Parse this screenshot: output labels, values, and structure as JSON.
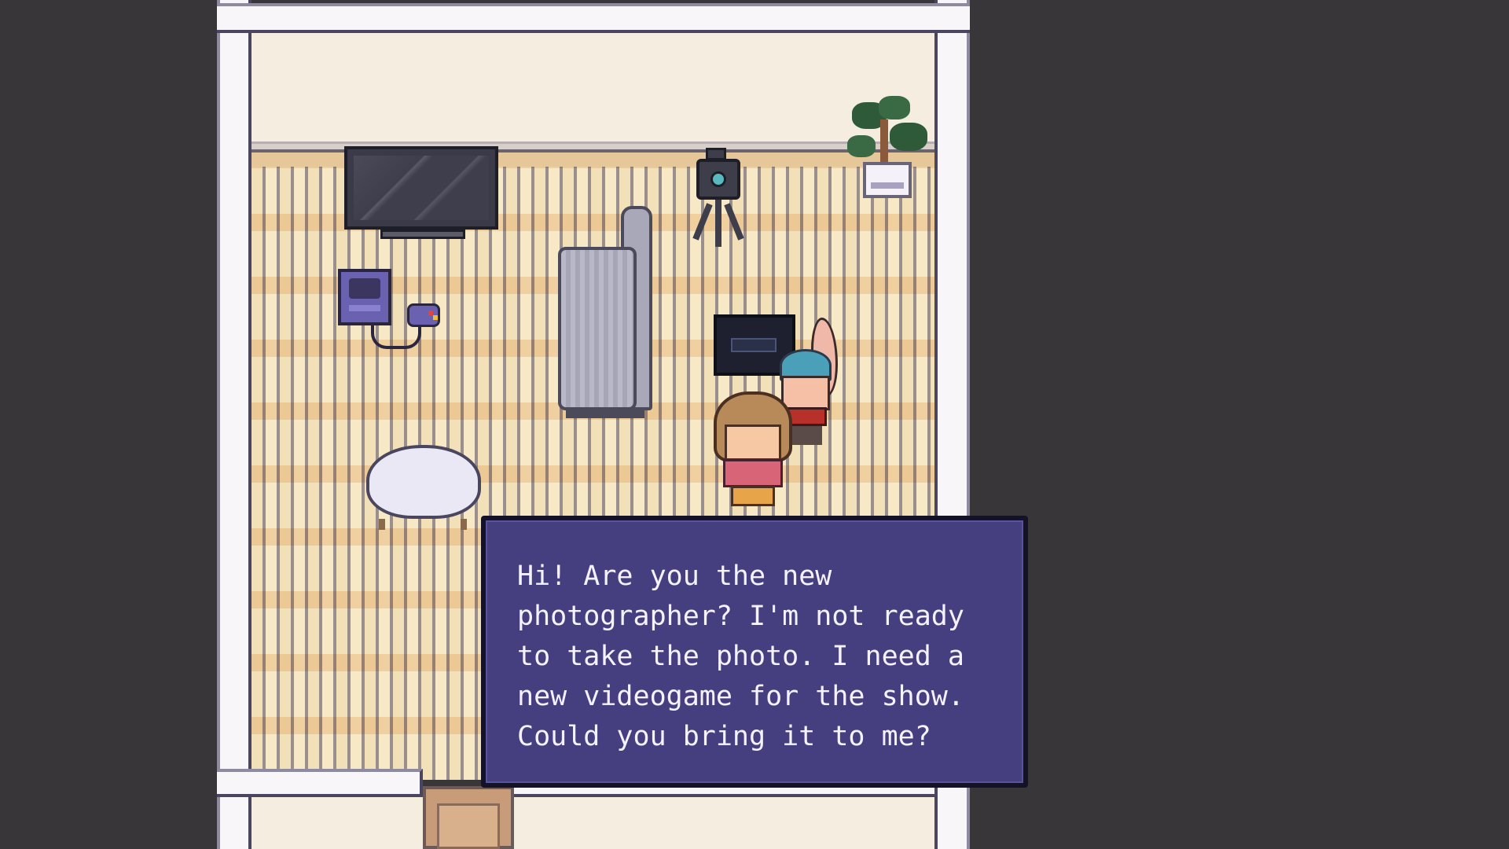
{
  "dialog": {
    "text": "Hi! Are you the new photographer? I'm not ready to take the photo. I need a new videogame for the show. Could you bring it to me?"
  },
  "scene": {
    "objects": [
      "television",
      "game-console",
      "game-controller",
      "sofa",
      "camera-tripod",
      "bonsai-plant",
      "arcade-machine",
      "round-chair",
      "door"
    ],
    "characters": [
      "photographer-player",
      "blue-haired-npc"
    ],
    "colors": {
      "background": "#39363a",
      "wall": "#f5ede0",
      "floor": "#f2e0b8",
      "dialog_bg": "#453f80",
      "dialog_text": "#f4f2ff"
    }
  }
}
